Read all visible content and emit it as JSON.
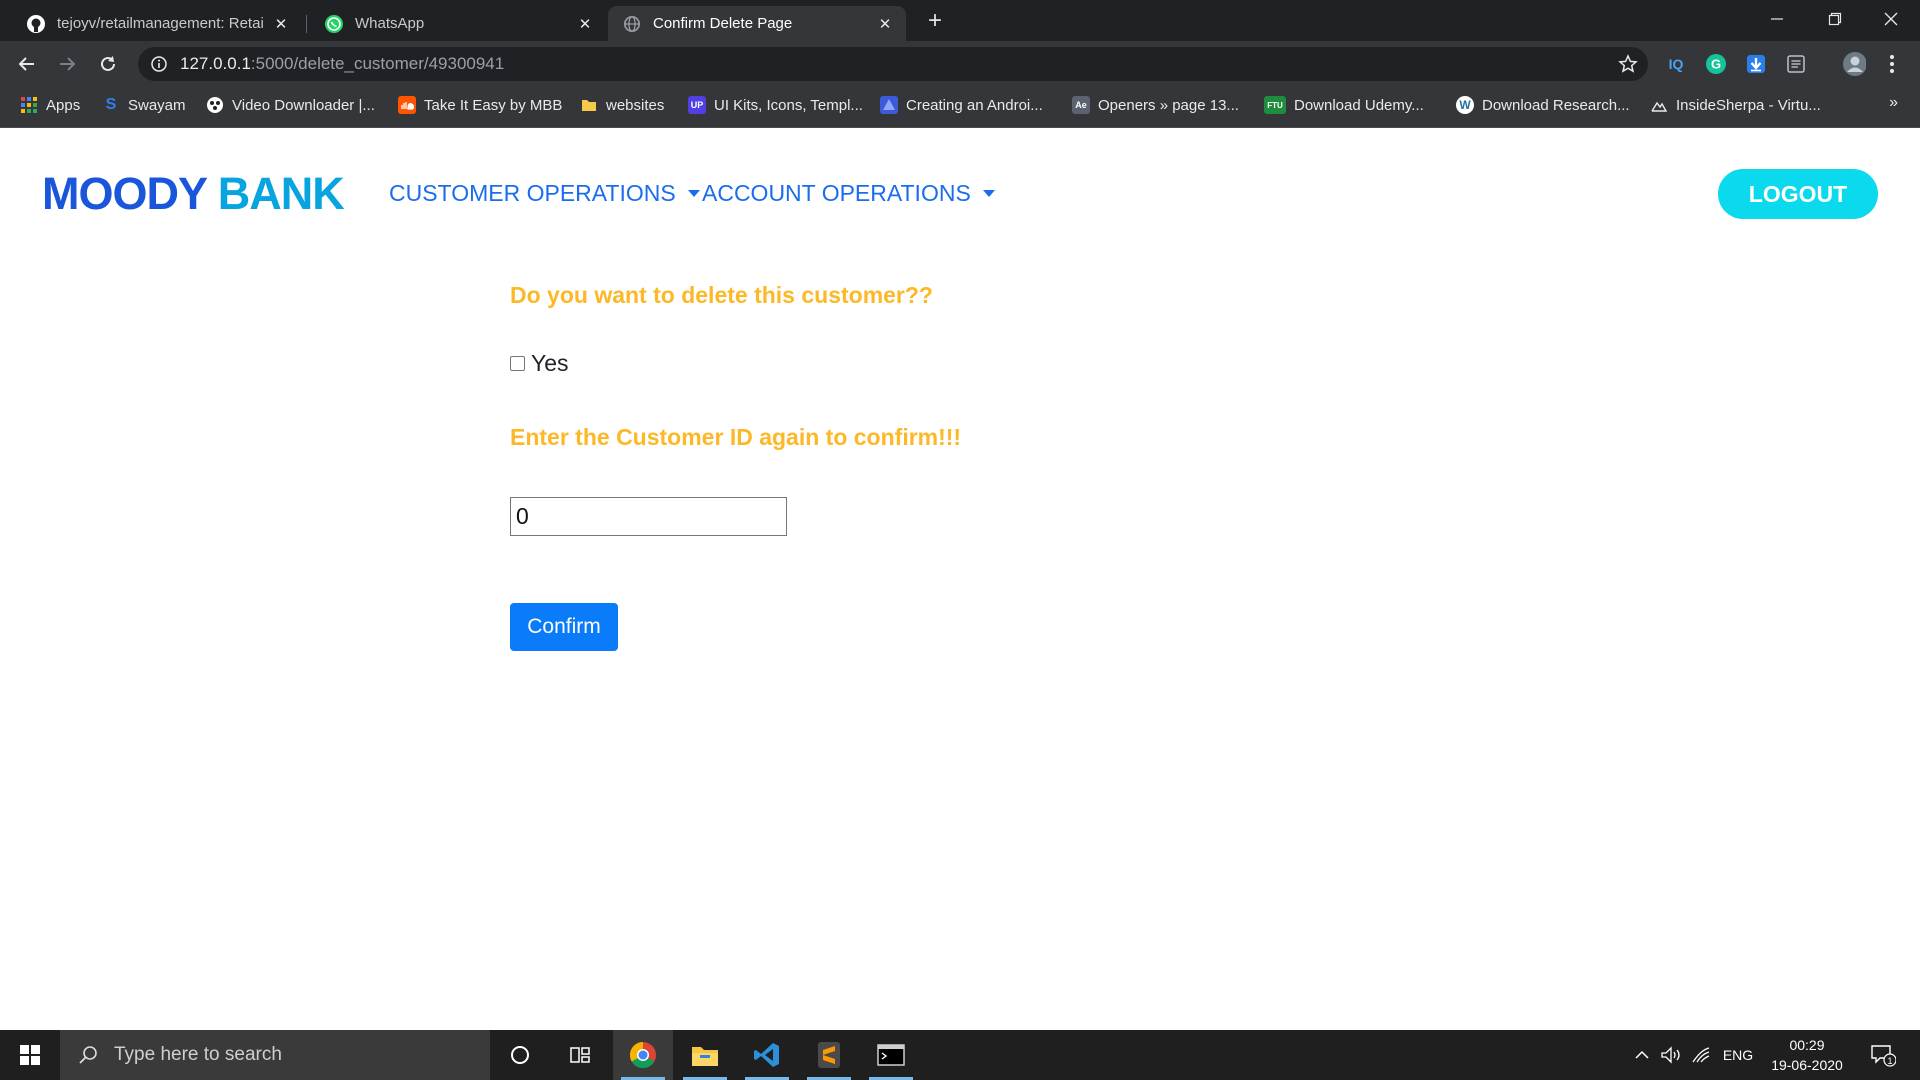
{
  "browser": {
    "tabs": [
      {
        "title": "tejoyv/retailmanagement: Retail M",
        "icon": "github-icon",
        "active": false
      },
      {
        "title": "WhatsApp",
        "icon": "whatsapp-icon",
        "active": false
      },
      {
        "title": "Confirm Delete Page",
        "icon": "globe-icon",
        "active": true
      }
    ],
    "address": {
      "host": "127.0.0.1",
      "path": ":5000/delete_customer/49300941"
    },
    "bookmarks": [
      {
        "label": "Apps",
        "icon": "apps-grid-icon"
      },
      {
        "label": "Swayam",
        "icon": "swayam-icon"
      },
      {
        "label": "Video Downloader |...",
        "icon": "video-downloader-icon"
      },
      {
        "label": "Take It Easy by MBB",
        "icon": "soundcloud-icon"
      },
      {
        "label": "websites",
        "icon": "folder-icon"
      },
      {
        "label": "UI Kits, Icons, Templ...",
        "icon": "uplabs-icon"
      },
      {
        "label": "Creating an Androi...",
        "icon": "android-course-icon"
      },
      {
        "label": "Openers » page 13...",
        "icon": "openers-icon"
      },
      {
        "label": "Download Udemy...",
        "icon": "ftu-icon"
      },
      {
        "label": "Download Research...",
        "icon": "wordpress-icon"
      },
      {
        "label": "InsideSherpa - Virtu...",
        "icon": "insidesherpa-icon"
      }
    ],
    "extensions": [
      {
        "label": "IQ",
        "icon": "iq-extension-icon"
      },
      {
        "label": "G",
        "icon": "grammarly-icon"
      }
    ]
  },
  "site": {
    "brand_part1": "MOODY",
    "brand_part2": "BANK",
    "nav": [
      {
        "label": "CUSTOMER OPERATIONS"
      },
      {
        "label": "ACCOUNT OPERATIONS"
      }
    ],
    "logout_label": "LOGOUT"
  },
  "form": {
    "question": "Do you want to delete this customer??",
    "checkbox_label": "Yes",
    "checkbox_checked": false,
    "confirm_prompt": "Enter the Customer ID again to confirm!!!",
    "customer_id_value": "0",
    "confirm_button": "Confirm"
  },
  "taskbar": {
    "search_placeholder": "Type here to search",
    "language": "ENG",
    "time": "00:29",
    "date": "19-06-2020",
    "notification_count": "1"
  },
  "colors": {
    "brand_dark": "#1a56db",
    "brand_light": "#08a4e0",
    "nav_link": "#1b6dee",
    "logout_bg": "#0bd9ee",
    "heading": "#fcb826",
    "confirm_bg": "#0a7cf9"
  }
}
